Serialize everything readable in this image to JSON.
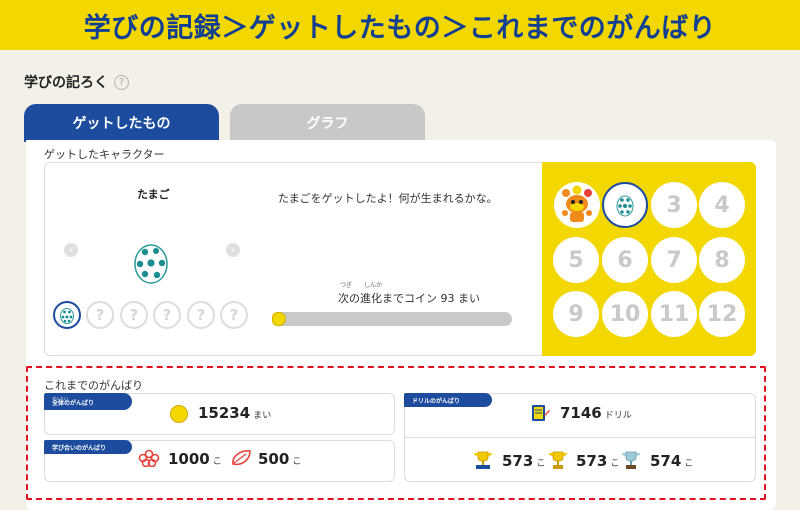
{
  "banner": {
    "title": "学びの記録＞ゲットしたもの＞これまでのがんばり"
  },
  "page": {
    "title": "学びの記ろく",
    "help_icon": "?"
  },
  "tabs": [
    {
      "label": "ゲットしたもの",
      "active": true
    },
    {
      "label": "グラフ",
      "active": false
    }
  ],
  "character": {
    "section_label": "ゲットしたキャラクター",
    "name": "たまご",
    "message": "たまごをゲットしたよ！何が生まれるかな。",
    "evolution": {
      "ruby_tsugi": "つぎ",
      "ruby_shinka": "しんか",
      "text_prefix": "次の進化までコイン",
      "coins": "93",
      "unit": "まい",
      "progress": 0.04
    },
    "slots": [
      "?",
      "?",
      "?",
      "?",
      "?"
    ],
    "grid_numbers": [
      "3",
      "4",
      "5",
      "6",
      "7",
      "8",
      "9",
      "10",
      "11",
      "12"
    ]
  },
  "efforts": {
    "section_label": "これまでのがんばり",
    "overall": {
      "tag_ruby": "ぜんたい",
      "tag": "全体のがんばり",
      "value": "15234",
      "unit": "まい"
    },
    "drill": {
      "tag": "ドリルのがんばり",
      "value": "7146",
      "unit": "ドリル"
    },
    "mutual": {
      "tag": "学び合いのがんばり",
      "flower_value": "1000",
      "flower_unit": "こ",
      "leaf_value": "500",
      "leaf_unit": "こ"
    },
    "trophies": [
      {
        "value": "573",
        "unit": "こ",
        "color": "#f3c800"
      },
      {
        "value": "573",
        "unit": "こ",
        "color": "#f3c800"
      },
      {
        "value": "574",
        "unit": "こ",
        "color": "#9ec9d6"
      }
    ]
  },
  "colors": {
    "brand_blue": "#1d4c9e",
    "yellow": "#f3d700",
    "highlight_red": "#e0101e"
  }
}
